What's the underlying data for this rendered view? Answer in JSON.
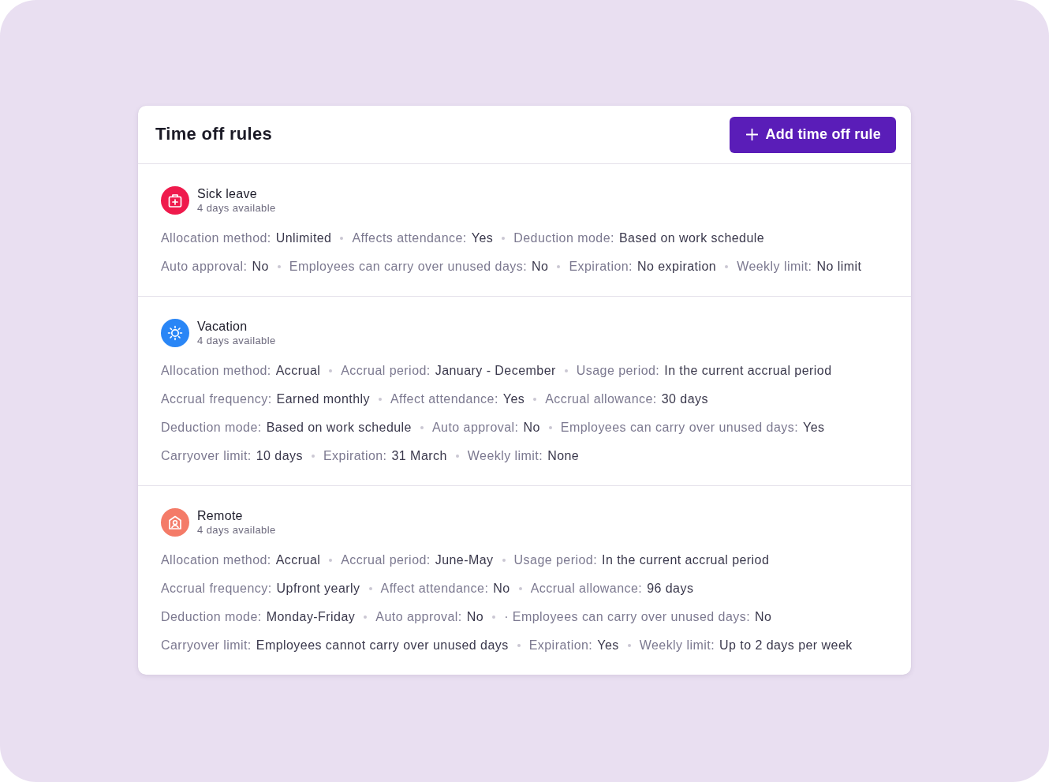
{
  "card": {
    "title": "Time off rules",
    "add_button": {
      "label": "Add time off rule"
    }
  },
  "rules": [
    {
      "name": "Sick leave",
      "availability": "4 days available",
      "color": "#ef1a4c",
      "lines": [
        {
          "items": [
            {
              "label": "Allocation method:",
              "value": "Unlimited"
            },
            {
              "label": "Affects attendance:",
              "value": "Yes"
            },
            {
              "label": "Deduction mode:",
              "value": "Based on work schedule"
            }
          ]
        },
        {
          "items": [
            {
              "label": "Auto approval:",
              "value": "No"
            },
            {
              "label": "Employees can carry over unused days:",
              "value": "No"
            },
            {
              "label": "Expiration:",
              "value": "No expiration"
            },
            {
              "label": "Weekly limit:",
              "value": "No limit"
            }
          ]
        }
      ]
    },
    {
      "name": "Vacation",
      "availability": "4 days available",
      "color": "#2a86f6",
      "lines": [
        {
          "items": [
            {
              "label": "Allocation method:",
              "value": "Accrual"
            },
            {
              "label": "Accrual period:",
              "value": "January - December"
            },
            {
              "label": "Usage period:",
              "value": "In the current accrual period"
            }
          ]
        },
        {
          "items": [
            {
              "label": "Accrual frequency:",
              "value": "Earned monthly"
            },
            {
              "label": "Affect attendance:",
              "value": "Yes"
            },
            {
              "label": "Accrual allowance:",
              "value": "30 days"
            }
          ]
        },
        {
          "items": [
            {
              "label": "Deduction mode:",
              "value": "Based on work schedule"
            },
            {
              "label": "Auto approval:",
              "value": "No"
            },
            {
              "label": "Employees can carry over unused days:",
              "value": "Yes"
            }
          ]
        },
        {
          "items": [
            {
              "label": "Carryover limit:",
              "value": "10 days"
            },
            {
              "label": "Expiration:",
              "value": "31 March"
            },
            {
              "label": "Weekly limit:",
              "value": "None"
            }
          ]
        }
      ]
    },
    {
      "name": "Remote",
      "availability": "4 days available",
      "color": "#f47b68",
      "lines": [
        {
          "items": [
            {
              "label": "Allocation method:",
              "value": "Accrual"
            },
            {
              "label": "Accrual period:",
              "value": "June-May"
            },
            {
              "label": "Usage period:",
              "value": "In the current accrual period"
            }
          ]
        },
        {
          "items": [
            {
              "label": "Accrual frequency:",
              "value": "Upfront yearly"
            },
            {
              "label": "Affect attendance:",
              "value": "No"
            },
            {
              "label": "Accrual allowance:",
              "value": "96 days"
            }
          ]
        },
        {
          "items": [
            {
              "label": "Deduction mode:",
              "value": "Monday-Friday"
            },
            {
              "label": "Auto approval:",
              "value": "No"
            },
            {
              "label": "· Employees can carry over unused days:",
              "value": "No"
            }
          ]
        },
        {
          "items": [
            {
              "label": "Carryover limit:",
              "value": "Employees cannot carry over unused days"
            },
            {
              "label": "Expiration:",
              "value": "Yes"
            },
            {
              "label": "Weekly limit:",
              "value": "Up to 2 days per week"
            }
          ]
        }
      ]
    }
  ]
}
